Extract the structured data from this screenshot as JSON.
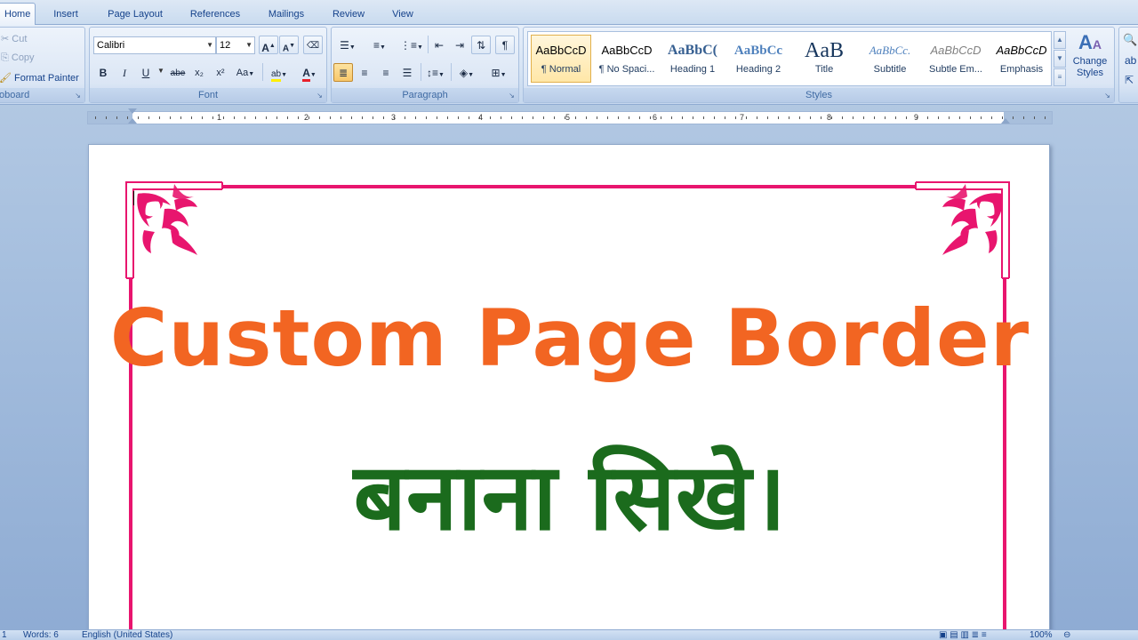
{
  "tabs": [
    "Home",
    "Insert",
    "Page Layout",
    "References",
    "Mailings",
    "Review",
    "View"
  ],
  "clipboard": {
    "cut": "Cut",
    "copy": "Copy",
    "format_painter": "Format Painter",
    "label": "oboard"
  },
  "font": {
    "name": "Calibri",
    "size": "12",
    "label": "Font",
    "bold": "B",
    "italic": "I",
    "underline": "U",
    "strike": "abe",
    "subscript": "x₂",
    "superscript": "x²",
    "change_case": "Aa",
    "grow": "A",
    "shrink": "A",
    "font_color_glyph": "A"
  },
  "paragraph": {
    "label": "Paragraph",
    "pilcrow": "¶"
  },
  "styles": {
    "label": "Styles",
    "items": [
      {
        "preview": "AaBbCcD",
        "name": "¶ Normal"
      },
      {
        "preview": "AaBbCcD",
        "name": "¶ No Spaci..."
      },
      {
        "preview": "AaBbC(",
        "name": "Heading 1"
      },
      {
        "preview": "AaBbCc",
        "name": "Heading 2"
      },
      {
        "preview": "AaB",
        "name": "Title"
      },
      {
        "preview": "AaBbCc.",
        "name": "Subtitle"
      },
      {
        "preview": "AaBbCcD",
        "name": "Subtle Em..."
      },
      {
        "preview": "AaBbCcD",
        "name": "Emphasis"
      }
    ],
    "change_styles": "Change Styles"
  },
  "ruler_numbers": [
    "1",
    "2",
    "3",
    "4",
    "5",
    "6",
    "7",
    "8",
    "9"
  ],
  "document": {
    "heading_en": "Custom Page Border",
    "heading_hi": "बनाना सिखे।"
  },
  "status": {
    "page": "1",
    "words": "Words: 6",
    "language": "English (United States)",
    "zoom": "100%"
  },
  "colors": {
    "border_pink": "#e8156e",
    "heading_orange": "#f26522",
    "heading_green": "#1b6b1d",
    "ribbon_text": "#15428b"
  }
}
